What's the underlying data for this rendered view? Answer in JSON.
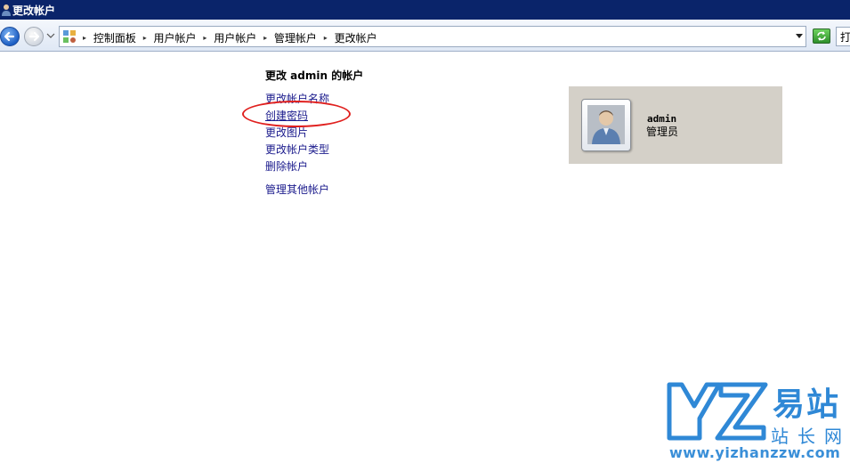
{
  "window": {
    "title": "更改帐户"
  },
  "address_bar": {
    "breadcrumbs": [
      "控制面板",
      "用户帐户",
      "用户帐户",
      "管理帐户",
      "更改帐户"
    ],
    "search_partial": "打"
  },
  "main": {
    "heading": "更改 admin 的帐户",
    "tasks": [
      {
        "label": "更改帐户名称"
      },
      {
        "label": "创建密码"
      },
      {
        "label": "更改图片"
      },
      {
        "label": "更改帐户类型"
      },
      {
        "label": "删除帐户"
      }
    ],
    "other_link": "管理其他帐户"
  },
  "account": {
    "name": "admin",
    "type": "管理员"
  },
  "watermark": {
    "logo_text": "YZ",
    "cn_top": "易站",
    "cn_bottom": "站长网",
    "url": "www.yizhanzzw.com"
  },
  "colors": {
    "titlebar": "#0a246a",
    "link": "#1a1a8c",
    "highlight": "#e0201e",
    "card_bg": "#d4d0c8",
    "watermark": "#2f88d6"
  }
}
